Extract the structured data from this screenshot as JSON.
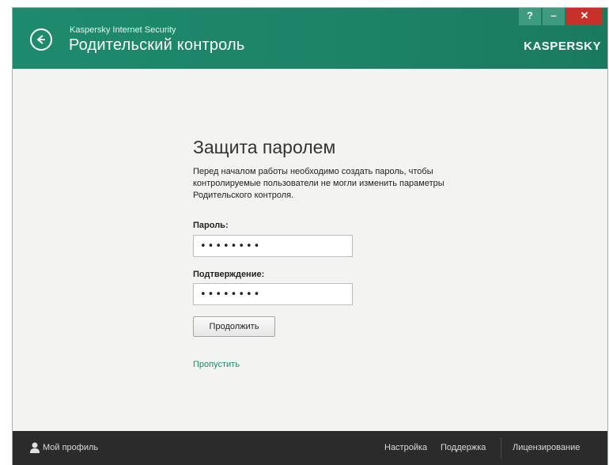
{
  "header": {
    "product_name": "Kaspersky Internet Security",
    "section_title": "Родительский контроль",
    "logo_text": "KASPERSKY",
    "window_controls": {
      "help": "?",
      "minimize": "–",
      "close": "✕"
    }
  },
  "main": {
    "title": "Защита паролем",
    "description": "Перед началом работы необходимо создать пароль, чтобы контролируемые пользователи не могли изменить параметры Родительского контроля.",
    "password_label": "Пароль:",
    "password_value": "••••••••",
    "confirm_label": "Подтверждение:",
    "confirm_value": "••••••••",
    "continue_button": "Продолжить",
    "skip_link": "Пропустить"
  },
  "footer": {
    "profile": "Мой профиль",
    "settings": "Настройка",
    "support": "Поддержка",
    "licensing": "Лицензирование"
  },
  "colors": {
    "header_green": "#1e8a6d",
    "link_green": "#1d8c6b",
    "footer_dark": "#2b2b2b",
    "close_red": "#c8302a"
  }
}
